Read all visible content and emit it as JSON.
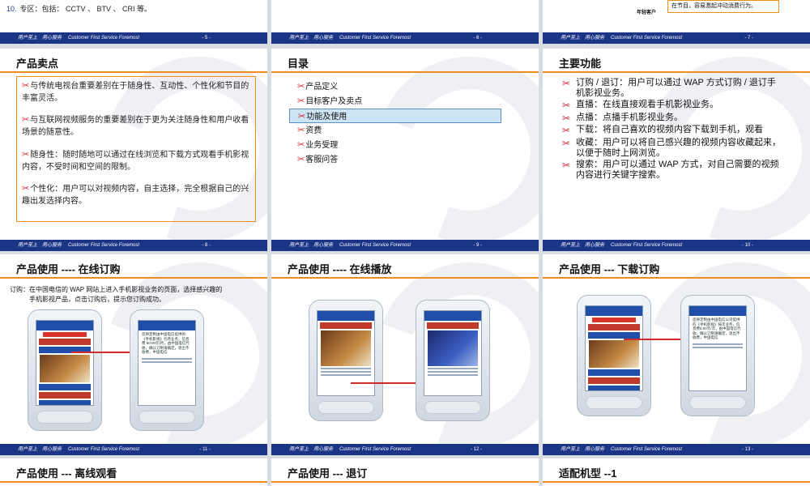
{
  "footer": {
    "slogan": "用户至上　用心服务",
    "slogan_en": "Customer First Service Foremost"
  },
  "slides": {
    "s5": {
      "page": "- 5 -",
      "item_num": "10.",
      "item_text": "专区：包括： CCTV 、 BTV 、 CRI 等。"
    },
    "s6": {
      "page": "- 6 -"
    },
    "s7": {
      "page": "- 7 -",
      "callout": "在节目，容易激起冲动消费行为。",
      "label": "年轻客户"
    },
    "s8": {
      "page": "- 8 -",
      "title": "产品卖点",
      "points": [
        "与传统电视台重要差别在于随身性、互动性、个性化和节目的丰富灵活。",
        "与互联网视频服务的重要差别在于更为关注随身性和用户收看场景的随意性。",
        "随身性：随时随地可以通过在线浏览和下载方式观看手机影视内容，不受时间和空间的限制。",
        "个性化：用户可以对视频内容，自主选择，完全根据自己的兴趣出发选择内容。"
      ]
    },
    "s9": {
      "page": "- 9 -",
      "title": "目录",
      "items": [
        "产品定义",
        "目标客户及卖点",
        "功能及使用",
        "资费",
        "业务受理",
        "客服问答"
      ],
      "active_index": 2
    },
    "s10": {
      "page": "- 10 -",
      "title": "主要功能",
      "features": [
        "订购 / 退订：用户可以通过 WAP 方式订购 / 退订手机影视业务。",
        "直播：在线直接观看手机影视业务。",
        "点播：点播手机影视业务。",
        "下载：将自己喜欢的视频内容下载到手机，观看",
        "收藏：用户可以将自己感兴趣的视频内容收藏起来，以便于随时上网浏览。",
        "搜索：用户可以通过 WAP 方式，对自己需要的视频内容进行关键字搜索。"
      ]
    },
    "s11": {
      "page": "- 11 -",
      "title": "产品使用 ---- 在线订购",
      "lead_1": "订购：在中国电信的 WAP 网站上进入手机影视业务的页面，选择感兴趣的",
      "lead_2": "手机影视产品，点击订购后，提示您订购成功。",
      "phone2_text": "您将定制由中国电信提供的《手机影视》包月业务，信息费 80.00元/月，由中国电信代收，确认订制请确定，退出不收费，中国电信"
    },
    "s12": {
      "page": "- 12 -",
      "title": "产品使用 ---- 在线播放"
    },
    "s13": {
      "page": "- 13 -",
      "title": "产品使用 --- 下载订购",
      "phone2_text": "您将定制由中国电信公司提供的《手机影视》按次业务，信息费5.00元/次，由中国电信代收，确认订制请确定，退出不收费，中国电信"
    },
    "s14": {
      "title": "产品使用 --- 离线观看"
    },
    "s15": {
      "title": "产品使用 --- 退订"
    },
    "s16": {
      "title": "适配机型 --1"
    }
  }
}
